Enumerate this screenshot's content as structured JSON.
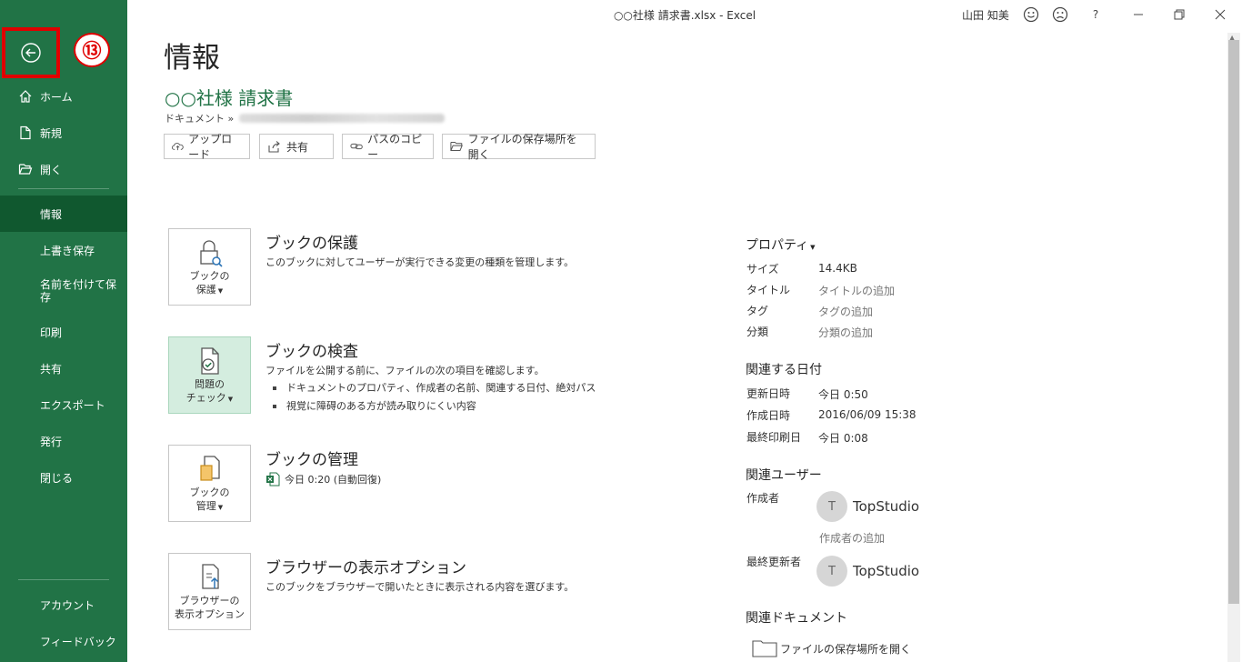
{
  "titlebar": {
    "title": "○○社様 請求書.xlsx  -  Excel",
    "user": "山田 知美",
    "help": "?",
    "icons": [
      "smile-icon",
      "frown-icon",
      "help-icon",
      "minimize-icon",
      "restore-icon",
      "close-icon"
    ]
  },
  "sidebar": {
    "step_badge": "⑬",
    "top_items": [
      {
        "label": "ホーム",
        "icon": "home-icon"
      },
      {
        "label": "新規",
        "icon": "new-document-icon"
      },
      {
        "label": "開く",
        "icon": "open-folder-icon"
      }
    ],
    "main_items": [
      {
        "label": "情報",
        "selected": true
      },
      {
        "label": "上書き保存"
      },
      {
        "label": "名前を付けて保存"
      },
      {
        "label": "印刷"
      },
      {
        "label": "共有"
      },
      {
        "label": "エクスポート"
      },
      {
        "label": "発行"
      },
      {
        "label": "閉じる"
      }
    ],
    "bottom_items": [
      {
        "label": "アカウント"
      },
      {
        "label": "フィードバック"
      }
    ],
    "colors": {
      "background": "#217346",
      "selected": "#10582f",
      "highlight": "#e00000"
    }
  },
  "header": {
    "page_title": "情報",
    "doc_title": "○○社様 請求書",
    "breadcrumb_prefix": "ドキュメント »",
    "actions": [
      {
        "label": "アップロード",
        "icon": "upload-cloud-icon"
      },
      {
        "label": "共有",
        "icon": "share-icon"
      },
      {
        "label": "パスのコピー",
        "icon": "link-icon"
      },
      {
        "label": "ファイルの保存場所を開く",
        "icon": "folder-icon"
      }
    ]
  },
  "sections": {
    "protect": {
      "box_label_1": "ブックの",
      "box_label_2": "保護",
      "title": "ブックの保護",
      "desc": "このブックに対してユーザーが実行できる変更の種類を管理します。"
    },
    "inspect": {
      "box_label_1": "問題の",
      "box_label_2": "チェック",
      "title": "ブックの検査",
      "desc": "ファイルを公開する前に、ファイルの次の項目を確認します。",
      "bullets": [
        "ドキュメントのプロパティ、作成者の名前、関連する日付、絶対パス",
        "視覚に障碍のある方が読み取りにくい内容"
      ]
    },
    "manage": {
      "box_label_1": "ブックの",
      "box_label_2": "管理",
      "title": "ブックの管理",
      "version": "今日 0:20 (自動回復)"
    },
    "browser": {
      "box_label_1": "ブラウザーの",
      "box_label_2": "表示オプション",
      "title": "ブラウザーの表示オプション",
      "desc": "このブックをブラウザーで開いたときに表示される内容を選びます。"
    }
  },
  "properties": {
    "heading": "プロパティ",
    "rows": [
      {
        "key": "サイズ",
        "value": "14.4KB"
      },
      {
        "key": "タイトル",
        "value": "タイトルの追加"
      },
      {
        "key": "タグ",
        "value": "タグの追加"
      },
      {
        "key": "分類",
        "value": "分類の追加"
      }
    ],
    "dates_heading": "関連する日付",
    "dates": [
      {
        "key": "更新日時",
        "value": "今日 0:50"
      },
      {
        "key": "作成日時",
        "value": "2016/06/09 15:38"
      },
      {
        "key": "最終印刷日",
        "value": "今日 0:08"
      }
    ],
    "people_heading": "関連ユーザー",
    "author_key": "作成者",
    "author_initial": "T",
    "author_name": "TopStudio",
    "add_author": "作成者の追加",
    "last_modified_key": "最終更新者",
    "last_modified_initial": "T",
    "last_modified_name": "TopStudio",
    "docs_heading": "関連ドキュメント",
    "open_location": "ファイルの保存場所を開く"
  }
}
